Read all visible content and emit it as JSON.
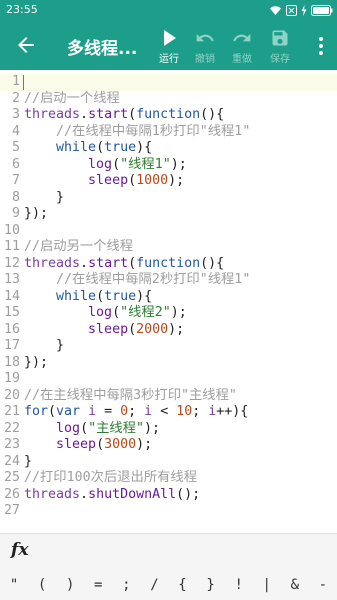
{
  "status": {
    "time": "23:55"
  },
  "toolbar": {
    "title": "多线程...",
    "run_label": "运行",
    "undo_label": "撤销",
    "redo_label": "重做",
    "save_label": "保存"
  },
  "editor": {
    "lines": [
      {
        "n": "1",
        "tokens": []
      },
      {
        "n": "2",
        "tokens": [
          {
            "c": "c",
            "t": "//启动一个线程"
          }
        ]
      },
      {
        "n": "3",
        "tokens": [
          {
            "c": "i",
            "t": "threads"
          },
          {
            "c": "p",
            "t": "."
          },
          {
            "c": "f",
            "t": "start"
          },
          {
            "c": "p",
            "t": "("
          },
          {
            "c": "k",
            "t": "function"
          },
          {
            "c": "p",
            "t": "(){"
          }
        ]
      },
      {
        "n": "4",
        "tokens": [
          {
            "c": "c",
            "t": "    //在线程中每隔1秒打印\"线程1\""
          }
        ]
      },
      {
        "n": "5",
        "tokens": [
          {
            "c": "p",
            "t": "    "
          },
          {
            "c": "k",
            "t": "while"
          },
          {
            "c": "p",
            "t": "("
          },
          {
            "c": "b",
            "t": "true"
          },
          {
            "c": "p",
            "t": "){"
          }
        ]
      },
      {
        "n": "6",
        "tokens": [
          {
            "c": "p",
            "t": "        "
          },
          {
            "c": "f",
            "t": "log"
          },
          {
            "c": "p",
            "t": "("
          },
          {
            "c": "s",
            "t": "\"线程1\""
          },
          {
            "c": "p",
            "t": ");"
          }
        ]
      },
      {
        "n": "7",
        "tokens": [
          {
            "c": "p",
            "t": "        "
          },
          {
            "c": "f",
            "t": "sleep"
          },
          {
            "c": "p",
            "t": "("
          },
          {
            "c": "n",
            "t": "1000"
          },
          {
            "c": "p",
            "t": ");"
          }
        ]
      },
      {
        "n": "8",
        "tokens": [
          {
            "c": "p",
            "t": "    }"
          }
        ]
      },
      {
        "n": "9",
        "tokens": [
          {
            "c": "p",
            "t": "});"
          }
        ]
      },
      {
        "n": "10",
        "tokens": []
      },
      {
        "n": "11",
        "tokens": [
          {
            "c": "c",
            "t": "//启动另一个线程"
          }
        ]
      },
      {
        "n": "12",
        "tokens": [
          {
            "c": "i",
            "t": "threads"
          },
          {
            "c": "p",
            "t": "."
          },
          {
            "c": "f",
            "t": "start"
          },
          {
            "c": "p",
            "t": "("
          },
          {
            "c": "k",
            "t": "function"
          },
          {
            "c": "p",
            "t": "(){"
          }
        ]
      },
      {
        "n": "13",
        "tokens": [
          {
            "c": "c",
            "t": "    //在线程中每隔2秒打印\"线程1\""
          }
        ]
      },
      {
        "n": "14",
        "tokens": [
          {
            "c": "p",
            "t": "    "
          },
          {
            "c": "k",
            "t": "while"
          },
          {
            "c": "p",
            "t": "("
          },
          {
            "c": "b",
            "t": "true"
          },
          {
            "c": "p",
            "t": "){"
          }
        ]
      },
      {
        "n": "15",
        "tokens": [
          {
            "c": "p",
            "t": "        "
          },
          {
            "c": "f",
            "t": "log"
          },
          {
            "c": "p",
            "t": "("
          },
          {
            "c": "s",
            "t": "\"线程2\""
          },
          {
            "c": "p",
            "t": ");"
          }
        ]
      },
      {
        "n": "16",
        "tokens": [
          {
            "c": "p",
            "t": "        "
          },
          {
            "c": "f",
            "t": "sleep"
          },
          {
            "c": "p",
            "t": "("
          },
          {
            "c": "n",
            "t": "2000"
          },
          {
            "c": "p",
            "t": ");"
          }
        ]
      },
      {
        "n": "17",
        "tokens": [
          {
            "c": "p",
            "t": "    }"
          }
        ]
      },
      {
        "n": "18",
        "tokens": [
          {
            "c": "p",
            "t": "});"
          }
        ]
      },
      {
        "n": "19",
        "tokens": []
      },
      {
        "n": "20",
        "tokens": [
          {
            "c": "c",
            "t": "//在主线程中每隔3秒打印\"主线程\""
          }
        ]
      },
      {
        "n": "21",
        "tokens": [
          {
            "c": "k",
            "t": "for"
          },
          {
            "c": "p",
            "t": "("
          },
          {
            "c": "k",
            "t": "var"
          },
          {
            "c": "p",
            "t": " "
          },
          {
            "c": "i",
            "t": "i"
          },
          {
            "c": "p",
            "t": " = "
          },
          {
            "c": "n",
            "t": "0"
          },
          {
            "c": "p",
            "t": "; "
          },
          {
            "c": "i",
            "t": "i"
          },
          {
            "c": "p",
            "t": " < "
          },
          {
            "c": "n",
            "t": "10"
          },
          {
            "c": "p",
            "t": "; "
          },
          {
            "c": "i",
            "t": "i"
          },
          {
            "c": "p",
            "t": "++){"
          }
        ]
      },
      {
        "n": "22",
        "tokens": [
          {
            "c": "p",
            "t": "    "
          },
          {
            "c": "f",
            "t": "log"
          },
          {
            "c": "p",
            "t": "("
          },
          {
            "c": "s",
            "t": "\"主线程\""
          },
          {
            "c": "p",
            "t": ");"
          }
        ]
      },
      {
        "n": "23",
        "tokens": [
          {
            "c": "p",
            "t": "    "
          },
          {
            "c": "f",
            "t": "sleep"
          },
          {
            "c": "p",
            "t": "("
          },
          {
            "c": "n",
            "t": "3000"
          },
          {
            "c": "p",
            "t": ");"
          }
        ]
      },
      {
        "n": "24",
        "tokens": [
          {
            "c": "p",
            "t": "}"
          }
        ]
      },
      {
        "n": "25",
        "tokens": [
          {
            "c": "c",
            "t": "//打印100次后退出所有线程"
          }
        ]
      },
      {
        "n": "26",
        "tokens": [
          {
            "c": "i",
            "t": "threads"
          },
          {
            "c": "p",
            "t": "."
          },
          {
            "c": "f",
            "t": "shutDownAll"
          },
          {
            "c": "p",
            "t": "();"
          }
        ]
      },
      {
        "n": "27",
        "tokens": []
      }
    ]
  },
  "bottom": {
    "fx_label": "fx",
    "symbols": [
      "\"",
      "(",
      ")",
      "=",
      ";",
      "/",
      "{",
      "}",
      "!",
      "|",
      "&",
      "-"
    ]
  },
  "colors": {
    "primary": "#1c9e8a",
    "comment": "#9e9e9e",
    "keyword": "#2357a5",
    "function": "#6a1b9a",
    "string": "#2e7d32",
    "number": "#b74a1b"
  },
  "icons": {
    "back": "arrow-left-icon",
    "run": "play-icon",
    "undo": "undo-icon",
    "redo": "redo-icon",
    "save": "floppy-disk-icon",
    "more": "more-vertical-icon"
  }
}
